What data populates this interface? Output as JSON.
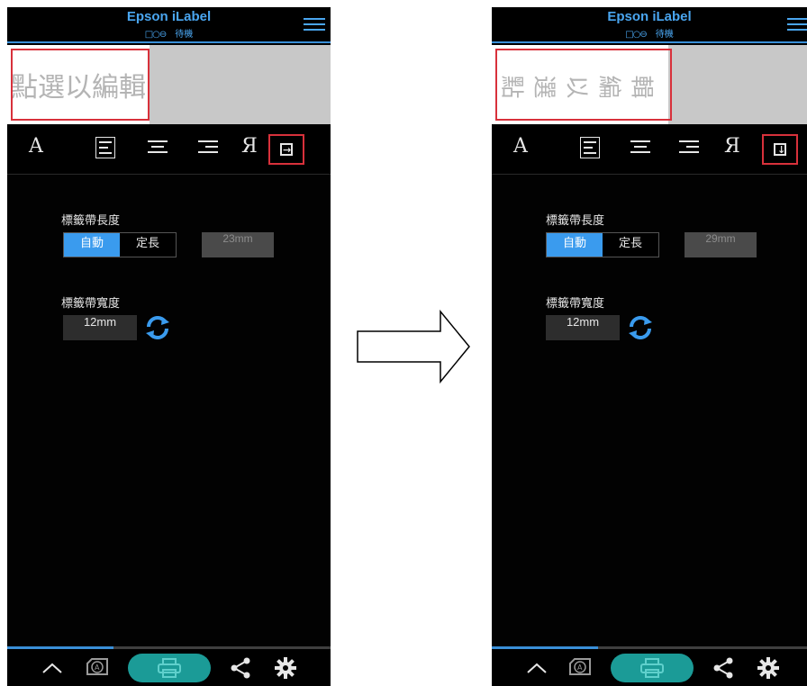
{
  "app": {
    "title": "Epson iLabel",
    "status_text": "待機",
    "status_icon": "□○⊖"
  },
  "screens": [
    {
      "label_text": "點選以編輯",
      "settings": {
        "tape_length_label": "標籤帶長度",
        "auto_label": "自動",
        "fixed_label": "定長",
        "length_value": "23mm",
        "tape_width_label": "標籤帶寬度",
        "width_value": "12mm"
      }
    },
    {
      "label_chars": [
        "點",
        "選",
        "以",
        "編",
        "輯"
      ],
      "settings": {
        "tape_length_label": "標籤帶長度",
        "auto_label": "自動",
        "fixed_label": "定長",
        "length_value": "29mm",
        "tape_width_label": "標籤帶寬度",
        "width_value": "12mm"
      }
    }
  ],
  "toolbar": {
    "font_glyph": "A",
    "reverse_glyph": "Я"
  },
  "colors": {
    "accent": "#3a9bee",
    "highlight": "#d8313b",
    "print_button": "#1b9b97"
  }
}
